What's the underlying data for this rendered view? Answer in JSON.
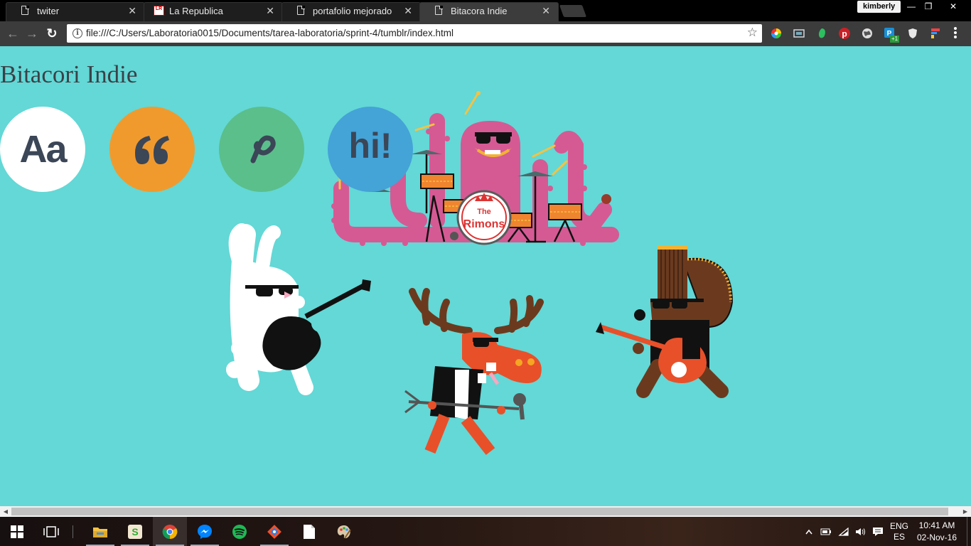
{
  "browser": {
    "tabs": [
      {
        "title": "twiter",
        "icon": "page-icon",
        "active": false
      },
      {
        "title": "La Republica",
        "icon": "la-republica-icon",
        "icon_text": "LR",
        "active": false
      },
      {
        "title": "portafolio mejorado",
        "icon": "page-icon",
        "active": false
      },
      {
        "title": "Bitacora Indie",
        "icon": "page-icon",
        "active": true
      }
    ],
    "profile": "kimberly",
    "url": "file:///C:/Users/Laboratoria0015/Documents/tarea-laboratoria/sprint-4/tumblr/index.html",
    "window_buttons": {
      "minimize": "—",
      "restore": "❐",
      "close": "✕"
    },
    "nav": {
      "back": "←",
      "forward": "→",
      "reload": "↻"
    },
    "extensions": [
      "color-picker-icon",
      "screen-capture-icon",
      "evernote-icon",
      "pinterest-icon",
      "globe-icon",
      "extension-badge-icon",
      "shield-icon",
      "flag-icon"
    ],
    "extension_badge": "+1"
  },
  "page": {
    "title": "Bitacori Indie",
    "circles": [
      {
        "label": "Aa",
        "bg": "#ffffff",
        "name": "font-circle"
      },
      {
        "label": "quote",
        "bg": "#f09a2e",
        "name": "quote-circle"
      },
      {
        "label": "link",
        "bg": "#5bbf8c",
        "name": "link-circle"
      },
      {
        "label": "hi!",
        "bg": "#44a3d7",
        "name": "chat-circle"
      }
    ],
    "drum_logo_top": "The",
    "drum_logo_bottom": "Rimons",
    "colors": {
      "background": "#63d8d6",
      "octopus": "#d55a94",
      "moose": "#e8502a",
      "rabbit": "#ffffff",
      "punk": "#6b3a1e"
    }
  },
  "taskbar": {
    "apps": [
      "start-icon",
      "task-view-icon",
      "file-explorer-icon",
      "slack-icon",
      "chrome-icon",
      "messenger-icon",
      "spotify-icon",
      "gitkraken-icon",
      "notepad-icon",
      "paint-icon"
    ],
    "tray": {
      "language_top": "ENG",
      "language_bottom": "ES",
      "time": "10:41 AM",
      "date": "02-Nov-16"
    }
  }
}
